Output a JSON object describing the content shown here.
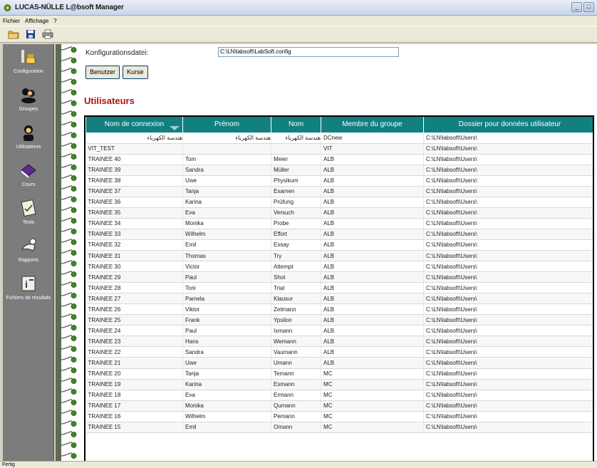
{
  "window": {
    "title": "LUCAS-NÜLLE L@bsoft Manager",
    "min": "_",
    "max": "□"
  },
  "menu": [
    "Fichier",
    "Affichage",
    "?"
  ],
  "toolbar": [
    {
      "icon": "open-folder-icon"
    },
    {
      "icon": "save-disk-icon"
    },
    {
      "icon": "printer-icon"
    }
  ],
  "sidebar": [
    {
      "label": "Configuration",
      "icon": "configuration-icon"
    },
    {
      "label": "Groupes",
      "icon": "groups-icon"
    },
    {
      "label": "Utilisateurs",
      "icon": "user-icon"
    },
    {
      "label": "Cours",
      "icon": "book-icon"
    },
    {
      "label": "Tests",
      "icon": "test-checklist-icon"
    },
    {
      "label": "Rapports",
      "icon": "reports-icon"
    },
    {
      "label": "Fichiers de résultats",
      "icon": "results-file-icon"
    }
  ],
  "config": {
    "label": "Konfigurationsdatei:",
    "value": "C:\\LN\\labsoft\\LabSoft.config"
  },
  "buttons": {
    "users": "Benutzer",
    "courses": "Kurse"
  },
  "section_title": "Utilisateurs",
  "table": {
    "columns": [
      "Nom de connexion",
      "Prénom",
      "Nom",
      "Membre du groupe",
      "Dossier pour données utilisateur"
    ],
    "rows": [
      [
        "هندسة الكهرباء",
        "هندسة الكهرباء",
        "هندسة الكهرباء",
        "DCnew",
        "C:\\LN\\labsoft\\Users\\"
      ],
      [
        "VIT_TEST",
        "",
        "",
        "VIT",
        "C:\\LN\\labsoft\\Users\\"
      ],
      [
        "TRAINEE 40",
        "Tom",
        "Meier",
        "ALB",
        "C:\\LN\\labsoft\\Users\\"
      ],
      [
        "TRAINEE 39",
        "Sandra",
        "Müller",
        "ALB",
        "C:\\LN\\labsoft\\Users\\"
      ],
      [
        "TRAINEE 38",
        "Uwe",
        "Physikum",
        "ALB",
        "C:\\LN\\labsoft\\Users\\"
      ],
      [
        "TRAINEE 37",
        "Tanja",
        "Examen",
        "ALB",
        "C:\\LN\\labsoft\\Users\\"
      ],
      [
        "TRAINEE 36",
        "Karina",
        "Prüfung",
        "ALB",
        "C:\\LN\\labsoft\\Users\\"
      ],
      [
        "TRAINEE 35",
        "Eva",
        "Versuch",
        "ALB",
        "C:\\LN\\labsoft\\Users\\"
      ],
      [
        "TRAINEE 34",
        "Monika",
        "Probe",
        "ALB",
        "C:\\LN\\labsoft\\Users\\"
      ],
      [
        "TRAINEE 33",
        "Wilhelm",
        "Effort",
        "ALB",
        "C:\\LN\\labsoft\\Users\\"
      ],
      [
        "TRAINEE 32",
        "Emil",
        "Essay",
        "ALB",
        "C:\\LN\\labsoft\\Users\\"
      ],
      [
        "TRAINEE 31",
        "Thomas",
        "Try",
        "ALB",
        "C:\\LN\\labsoft\\Users\\"
      ],
      [
        "TRAINEE 30",
        "Victor",
        "Attempt",
        "ALB",
        "C:\\LN\\labsoft\\Users\\"
      ],
      [
        "TRAINEE 29",
        "Paul",
        "Shot",
        "ALB",
        "C:\\LN\\labsoft\\Users\\"
      ],
      [
        "TRAINEE 28",
        "Toni",
        "Trial",
        "ALB",
        "C:\\LN\\labsoft\\Users\\"
      ],
      [
        "TRAINEE 27",
        "Pamela",
        "Klausur",
        "ALB",
        "C:\\LN\\labsoft\\Users\\"
      ],
      [
        "TRAINEE 26",
        "Viktor",
        "Zetmann",
        "ALB",
        "C:\\LN\\labsoft\\Users\\"
      ],
      [
        "TRAINEE 25",
        "Frank",
        "Ypsilon",
        "ALB",
        "C:\\LN\\labsoft\\Users\\"
      ],
      [
        "TRAINEE 24",
        "Paul",
        "Ixmann",
        "ALB",
        "C:\\LN\\labsoft\\Users\\"
      ],
      [
        "TRAINEE 23",
        "Hans",
        "Wemann",
        "ALB",
        "C:\\LN\\labsoft\\Users\\"
      ],
      [
        "TRAINEE 22",
        "Sandra",
        "Vaumann",
        "ALB",
        "C:\\LN\\labsoft\\Users\\"
      ],
      [
        "TRAINEE 21",
        "Uwe",
        "Umann",
        "ALB",
        "C:\\LN\\labsoft\\Users\\"
      ],
      [
        "TRAINEE 20",
        "Tanja",
        "Temann",
        "MC",
        "C:\\LN\\labsoft\\Users\\"
      ],
      [
        "TRAINEE 19",
        "Karina",
        "Esmann",
        "MC",
        "C:\\LN\\labsoft\\Users\\"
      ],
      [
        "TRAINEE 18",
        "Eva",
        "Ermann",
        "MC",
        "C:\\LN\\labsoft\\Users\\"
      ],
      [
        "TRAINEE 17",
        "Monika",
        "Qumann",
        "MC",
        "C:\\LN\\labsoft\\Users\\"
      ],
      [
        "TRAINEE 16",
        "Wilhelm",
        "Pemann",
        "MC",
        "C:\\LN\\labsoft\\Users\\"
      ],
      [
        "TRAINEE 15",
        "Emil",
        "Omann",
        "MC",
        "C:\\LN\\labsoft\\Users\\"
      ]
    ]
  },
  "status": "Fertig",
  "colors": {
    "header_bg": "#128080",
    "title_red": "#b01212",
    "sidebar_bg": "#7c7c7c"
  }
}
